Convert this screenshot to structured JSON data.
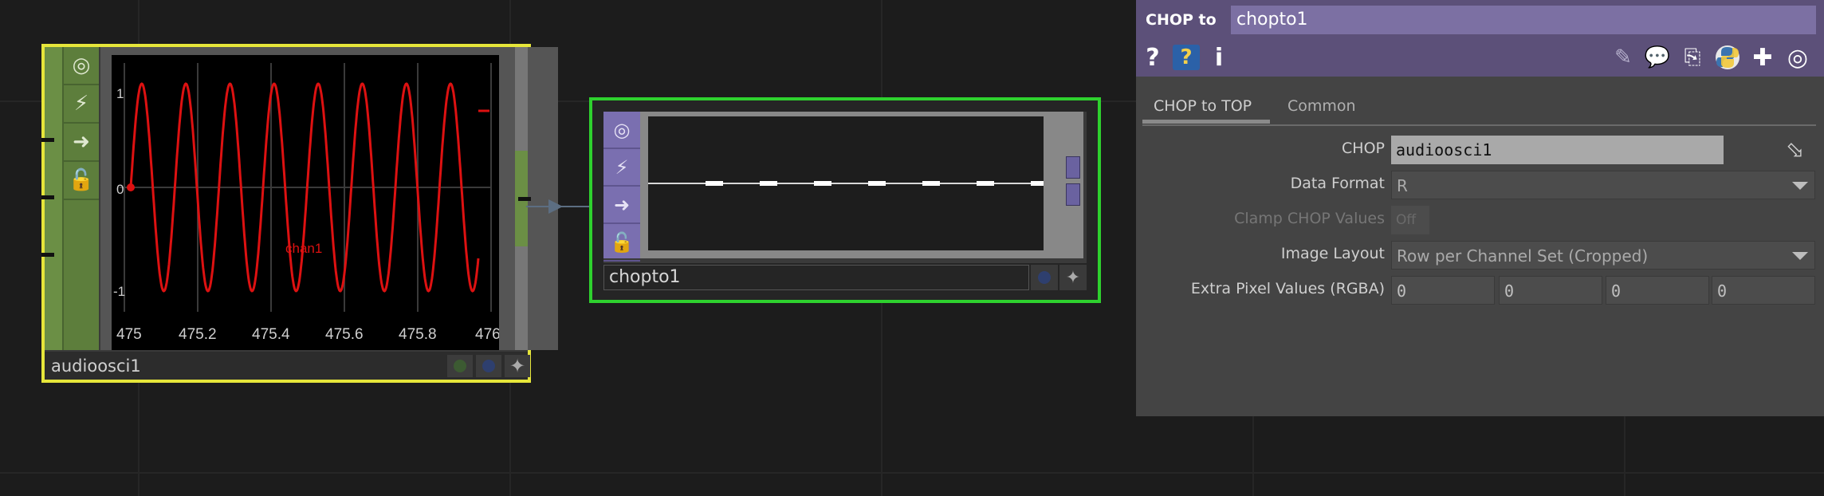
{
  "network": {
    "source_node": {
      "name": "audioosci1",
      "viewer": {
        "channel_label": "chan1",
        "y_ticks": [
          "1",
          "0",
          "-1"
        ],
        "x_ticks": [
          "475",
          "475.2",
          "475.4",
          "475.6",
          "475.8",
          "476"
        ],
        "cycles_visible": 8,
        "wave_color": "#dd1111"
      },
      "border_color": "#e6e63a",
      "family_color": "#6b8f45"
    },
    "target_node": {
      "name": "chopto1",
      "border_color": "#2ed12e",
      "family_color": "#7a6fb0"
    }
  },
  "panel": {
    "op_type": "CHOP to",
    "op_name": "chopto1",
    "header_icons": [
      "help-icon",
      "python-help-icon",
      "info-icon",
      "edit-icon",
      "comment-icon",
      "clipboard-icon",
      "python-icon",
      "add-icon",
      "target-icon"
    ],
    "help_label": "?",
    "info_label": "i",
    "tabs": [
      {
        "label": "CHOP to TOP",
        "active": true
      },
      {
        "label": "Common",
        "active": false
      }
    ],
    "params": {
      "chop": {
        "label": "CHOP",
        "value": "audioosci1"
      },
      "data_format": {
        "label": "Data Format",
        "value": "R"
      },
      "clamp": {
        "label": "Clamp CHOP Values",
        "value": "Off"
      },
      "image_layout": {
        "label": "Image Layout",
        "value": "Row per Channel Set (Cropped)"
      },
      "extra_pixel": {
        "label": "Extra Pixel Values (RGBA)",
        "values": [
          "0",
          "0",
          "0",
          "0"
        ]
      }
    }
  }
}
